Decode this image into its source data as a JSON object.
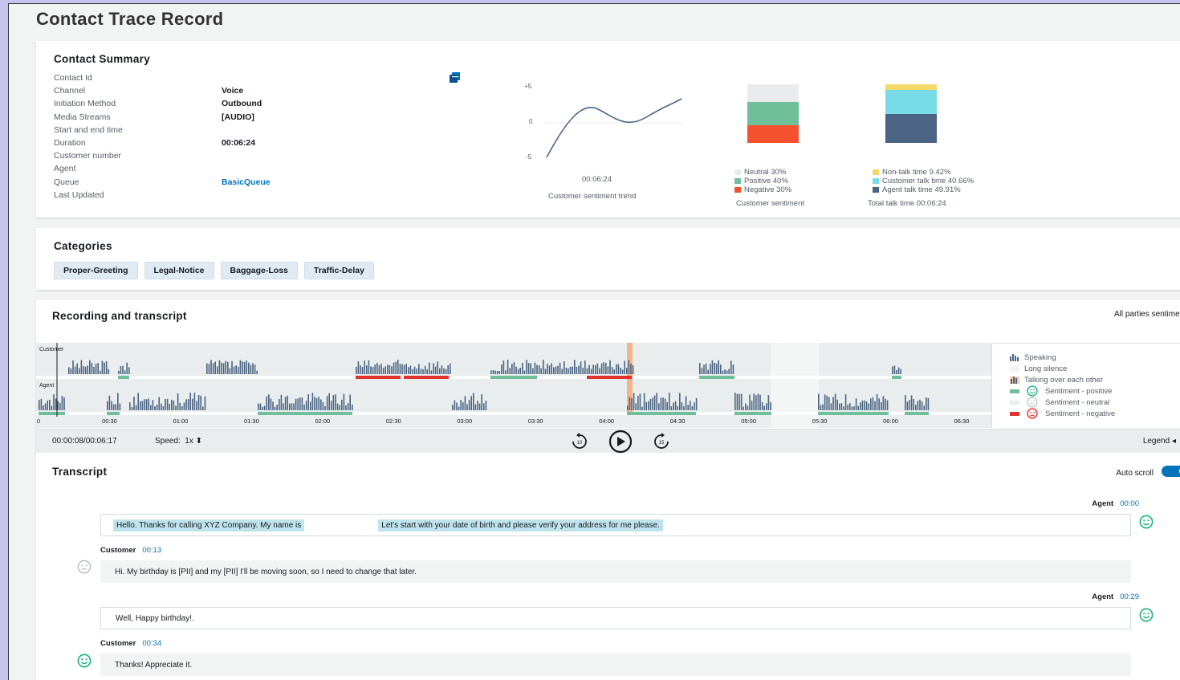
{
  "page_title": "Contact Trace Record",
  "summary": {
    "title": "Contact Summary",
    "fields": [
      {
        "label": "Contact Id",
        "value": ""
      },
      {
        "label": "Channel",
        "value": "Voice"
      },
      {
        "label": "Initiation Method",
        "value": "Outbound"
      },
      {
        "label": "Media Streams",
        "value": "[AUDIO]"
      },
      {
        "label": "Start and end time",
        "value": ""
      },
      {
        "label": "Duration",
        "value": "00:06:24"
      },
      {
        "label": "Customer number",
        "value": ""
      },
      {
        "label": "Agent",
        "value": ""
      },
      {
        "label": "Queue",
        "value": "BasicQueue"
      },
      {
        "label": "Last Updated",
        "value": ""
      }
    ],
    "trend": {
      "y_ticks": [
        "+5",
        "0",
        "-5"
      ],
      "x_label": "00:06:24",
      "caption": "Customer sentiment trend"
    },
    "customer_sentiment": {
      "legend": [
        "Neutral 30%",
        "Positive 40%",
        "Negative 30%"
      ],
      "caption": "Customer sentiment",
      "values": [
        30,
        40,
        30
      ],
      "colors": [
        "#e9ebed",
        "#6fbf9a",
        "#f5512f"
      ]
    },
    "talk_time": {
      "legend": [
        "Non-talk time 9.42%",
        "Customer talk time 40.66%",
        "Agent talk time 49.91%"
      ],
      "caption": "Total talk time 00:06:24",
      "values": [
        9.42,
        40.66,
        49.91
      ],
      "colors": [
        "#f6d96b",
        "#7adbe8",
        "#4b6483"
      ]
    }
  },
  "categories": {
    "title": "Categories",
    "items": [
      "Proper-Greeting",
      "Legal-Notice",
      "Baggage-Loss",
      "Traffic-Delay"
    ]
  },
  "recording": {
    "title": "Recording and transcript",
    "all_parties": "All parties sentiment",
    "customer_label": "Customer",
    "agent_label": "Agent",
    "ticks": [
      "0",
      "00:30",
      "01:00",
      "01:30",
      "02:00",
      "02:30",
      "03:00",
      "03:30",
      "04:00",
      "04:30",
      "05:00",
      "05:30",
      "06:00",
      "06:30"
    ],
    "position": "00:00:08/00:06:17",
    "speed_label": "Speed:",
    "speed_value": "1x",
    "legend_button": "Legend",
    "legend": [
      "Speaking",
      "Long silence",
      "Talking over each other",
      "Sentiment - positive",
      "Sentiment - neutral",
      "Sentiment - negative"
    ]
  },
  "transcript": {
    "title": "Transcript",
    "auto_scroll": "Auto scroll",
    "turns": [
      {
        "speaker": "Agent",
        "time": "00:00",
        "text_a": "Hello. Thanks for calling XYZ Company. My name is",
        "text_b": "Let's start with your date of birth and please verify your address for me please."
      },
      {
        "speaker": "Customer",
        "time": "00:13",
        "text": "Hi. My birthday is [PII] and my [PII] I'll be moving soon, so I need to change that later."
      },
      {
        "speaker": "Agent",
        "time": "00:29",
        "text": "Well, Happy birthday!."
      },
      {
        "speaker": "Customer",
        "time": "00:34",
        "text": "Thanks! Appreciate it."
      }
    ]
  },
  "colors": {
    "positive": "#1db27e",
    "neutral": "#aab7b8",
    "negative": "#e0312f",
    "link": "#0073bb",
    "bar": "#4b6483"
  }
}
